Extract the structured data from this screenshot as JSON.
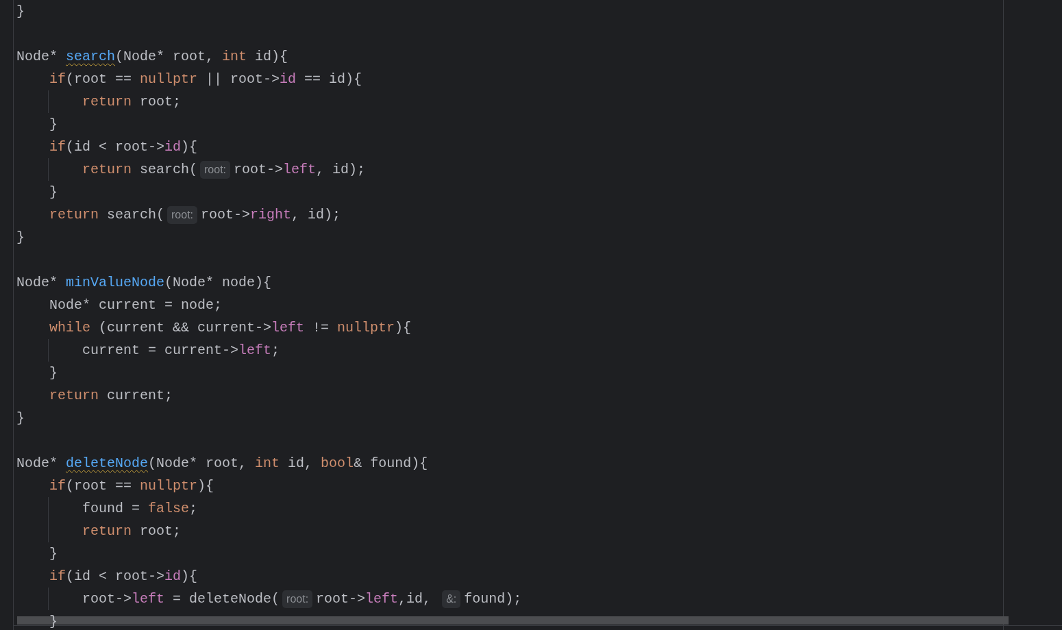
{
  "editor": {
    "lines": [
      {
        "tokens": [
          {
            "kind": "plain",
            "text": "}"
          }
        ]
      },
      {
        "blank_before": true,
        "tokens": [
          {
            "kind": "plain",
            "text": "Node* "
          },
          {
            "kind": "function",
            "text": "search",
            "warning": true
          },
          {
            "kind": "plain",
            "text": "(Node* root, "
          },
          {
            "kind": "keyword",
            "text": "int"
          },
          {
            "kind": "plain",
            "text": " id){"
          }
        ],
        "children": [
          {
            "tokens": [
              {
                "kind": "keyword",
                "text": "if"
              },
              {
                "kind": "plain",
                "text": "(root == "
              },
              {
                "kind": "keyword",
                "text": "nullptr"
              },
              {
                "kind": "plain",
                "text": " || root->"
              },
              {
                "kind": "field",
                "text": "id"
              },
              {
                "kind": "plain",
                "text": " == id){"
              }
            ],
            "children": [
              {
                "tokens": [
                  {
                    "kind": "keyword",
                    "text": "return"
                  },
                  {
                    "kind": "plain",
                    "text": " root;"
                  }
                ]
              }
            ]
          },
          {
            "tokens": [
              {
                "kind": "plain",
                "text": "}"
              }
            ]
          },
          {
            "tokens": [
              {
                "kind": "keyword",
                "text": "if"
              },
              {
                "kind": "plain",
                "text": "(id < root->"
              },
              {
                "kind": "field",
                "text": "id"
              },
              {
                "kind": "plain",
                "text": "){"
              }
            ],
            "children": [
              {
                "tokens": [
                  {
                    "kind": "keyword",
                    "text": "return"
                  },
                  {
                    "kind": "plain",
                    "text": " search("
                  },
                  {
                    "kind": "hint",
                    "text": "root:"
                  },
                  {
                    "kind": "plain",
                    "text": "root->"
                  },
                  {
                    "kind": "field",
                    "text": "left"
                  },
                  {
                    "kind": "plain",
                    "text": ", id);"
                  }
                ]
              }
            ]
          },
          {
            "tokens": [
              {
                "kind": "plain",
                "text": "}"
              }
            ]
          },
          {
            "tokens": [
              {
                "kind": "keyword",
                "text": "return"
              },
              {
                "kind": "plain",
                "text": " search("
              },
              {
                "kind": "hint",
                "text": "root:"
              },
              {
                "kind": "plain",
                "text": "root->"
              },
              {
                "kind": "field",
                "text": "right"
              },
              {
                "kind": "plain",
                "text": ", id);"
              }
            ]
          }
        ]
      },
      {
        "tokens": [
          {
            "kind": "plain",
            "text": "}"
          }
        ]
      },
      {
        "blank_before": true,
        "tokens": [
          {
            "kind": "plain",
            "text": "Node* "
          },
          {
            "kind": "function",
            "text": "minValueNode",
            "warning": false
          },
          {
            "kind": "plain",
            "text": "(Node* node){"
          }
        ],
        "children": [
          {
            "tokens": [
              {
                "kind": "plain",
                "text": "Node* current = node;"
              }
            ]
          },
          {
            "tokens": [
              {
                "kind": "keyword",
                "text": "while"
              },
              {
                "kind": "plain",
                "text": " (current && current->"
              },
              {
                "kind": "field",
                "text": "left"
              },
              {
                "kind": "plain",
                "text": " != "
              },
              {
                "kind": "keyword",
                "text": "nullptr"
              },
              {
                "kind": "plain",
                "text": "){"
              }
            ],
            "children": [
              {
                "tokens": [
                  {
                    "kind": "plain",
                    "text": "current = current->"
                  },
                  {
                    "kind": "field",
                    "text": "left"
                  },
                  {
                    "kind": "plain",
                    "text": ";"
                  }
                ]
              }
            ]
          },
          {
            "tokens": [
              {
                "kind": "plain",
                "text": "}"
              }
            ]
          },
          {
            "tokens": [
              {
                "kind": "keyword",
                "text": "return"
              },
              {
                "kind": "plain",
                "text": " current;"
              }
            ]
          }
        ]
      },
      {
        "tokens": [
          {
            "kind": "plain",
            "text": "}"
          }
        ]
      },
      {
        "blank_before": true,
        "tokens": [
          {
            "kind": "plain",
            "text": "Node* "
          },
          {
            "kind": "function",
            "text": "deleteNode",
            "warning": true
          },
          {
            "kind": "plain",
            "text": "(Node* root, "
          },
          {
            "kind": "keyword",
            "text": "int"
          },
          {
            "kind": "plain",
            "text": " id, "
          },
          {
            "kind": "keyword",
            "text": "bool"
          },
          {
            "kind": "plain",
            "text": "& found){"
          }
        ],
        "children": [
          {
            "tokens": [
              {
                "kind": "keyword",
                "text": "if"
              },
              {
                "kind": "plain",
                "text": "(root == "
              },
              {
                "kind": "keyword",
                "text": "nullptr"
              },
              {
                "kind": "plain",
                "text": "){"
              }
            ],
            "children": [
              {
                "tokens": [
                  {
                    "kind": "plain",
                    "text": "found = "
                  },
                  {
                    "kind": "keyword",
                    "text": "false"
                  },
                  {
                    "kind": "plain",
                    "text": ";"
                  }
                ]
              },
              {
                "tokens": [
                  {
                    "kind": "keyword",
                    "text": "return"
                  },
                  {
                    "kind": "plain",
                    "text": " root;"
                  }
                ]
              }
            ]
          },
          {
            "tokens": [
              {
                "kind": "plain",
                "text": "}"
              }
            ]
          },
          {
            "tokens": [
              {
                "kind": "keyword",
                "text": "if"
              },
              {
                "kind": "plain",
                "text": "(id < root->"
              },
              {
                "kind": "field",
                "text": "id"
              },
              {
                "kind": "plain",
                "text": "){"
              }
            ],
            "children": [
              {
                "tokens": [
                  {
                    "kind": "plain",
                    "text": "root->"
                  },
                  {
                    "kind": "field",
                    "text": "left"
                  },
                  {
                    "kind": "plain",
                    "text": " = deleteNode("
                  },
                  {
                    "kind": "hint",
                    "text": "root:"
                  },
                  {
                    "kind": "plain",
                    "text": "root->"
                  },
                  {
                    "kind": "field",
                    "text": "left"
                  },
                  {
                    "kind": "plain",
                    "text": ",id, "
                  },
                  {
                    "kind": "hint",
                    "text": "&:"
                  },
                  {
                    "kind": "plain",
                    "text": "found);"
                  }
                ]
              }
            ]
          },
          {
            "tokens": [
              {
                "kind": "plain",
                "text": "}"
              }
            ]
          }
        ]
      }
    ]
  }
}
